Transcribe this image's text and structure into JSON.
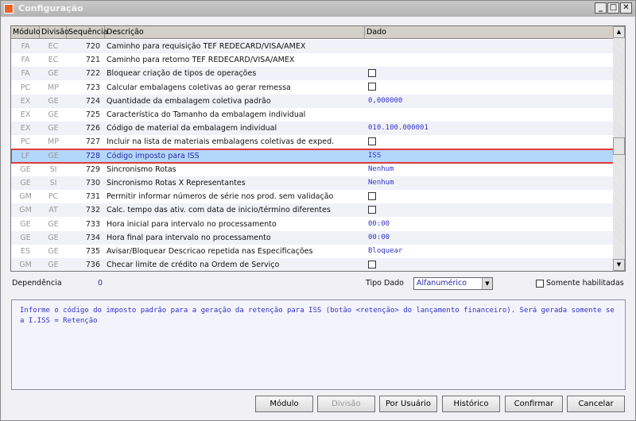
{
  "window": {
    "title": "Configuração",
    "controls": [
      "_",
      "□",
      "✕"
    ]
  },
  "grid": {
    "columns": [
      "Módulo",
      "Divisão",
      "Sequência",
      "Descrição",
      "Dado"
    ],
    "rows": [
      {
        "modulo": "FA",
        "divisao": "EC",
        "seq": "720",
        "descricao": "Caminho para requisição TEF REDECARD/VISA/AMEX",
        "dado": ""
      },
      {
        "modulo": "FA",
        "divisao": "EC",
        "seq": "721",
        "descricao": "Caminho para retorno TEF REDECARD/VISA/AMEX",
        "dado": ""
      },
      {
        "modulo": "FA",
        "divisao": "GE",
        "seq": "722",
        "descricao": "Bloquear criação de tipos de operações",
        "checkbox": true
      },
      {
        "modulo": "PC",
        "divisao": "MP",
        "seq": "723",
        "descricao": "Calcular embalagens coletivas ao gerar remessa",
        "checkbox": true
      },
      {
        "modulo": "EX",
        "divisao": "GE",
        "seq": "724",
        "descricao": "Quantidade da embalagem coletiva padrão",
        "dado": "0,000000"
      },
      {
        "modulo": "EX",
        "divisao": "GE",
        "seq": "725",
        "descricao": "Característica do Tamanho da embalagem individual",
        "dado": ""
      },
      {
        "modulo": "EX",
        "divisao": "GE",
        "seq": "726",
        "descricao": "Código de material da embalagem individual",
        "dado": "010.100.000001"
      },
      {
        "modulo": "PC",
        "divisao": "MP",
        "seq": "727",
        "descricao": "Incluir na lista de materiais embalagens coletivas de exped.",
        "checkbox": true
      },
      {
        "modulo": "LF",
        "divisao": "GE",
        "seq": "728",
        "descricao": "Código imposto para ISS",
        "dado": "ISS",
        "selected": true
      },
      {
        "modulo": "GE",
        "divisao": "SI",
        "seq": "729",
        "descricao": "Sincronismo Rotas",
        "dado": "Nenhum"
      },
      {
        "modulo": "GE",
        "divisao": "SI",
        "seq": "730",
        "descricao": "Sincronismo Rotas X Representantes",
        "dado": "Nenhum"
      },
      {
        "modulo": "GM",
        "divisao": "PC",
        "seq": "731",
        "descricao": "Permitir informar números de série nos prod. sem validação",
        "checkbox": true
      },
      {
        "modulo": "GM",
        "divisao": "AT",
        "seq": "732",
        "descricao": "Calc. tempo das ativ. com data de inicio/término diferentes",
        "checkbox": true
      },
      {
        "modulo": "GE",
        "divisao": "GE",
        "seq": "733",
        "descricao": "Hora inicial para intervalo no processamento",
        "dado": "00:00"
      },
      {
        "modulo": "GE",
        "divisao": "GE",
        "seq": "734",
        "descricao": "Hora final para intervalo no processamento",
        "dado": "00:00"
      },
      {
        "modulo": "ES",
        "divisao": "GE",
        "seq": "735",
        "descricao": "Avisar/Bloquear Descricao repetida nas Especificações",
        "dado": "Bloquear"
      },
      {
        "modulo": "GM",
        "divisao": "GE",
        "seq": "736",
        "descricao": "Checar limite de crédito na Ordem de Serviço",
        "checkbox": true
      }
    ]
  },
  "footer": {
    "dependencia_label": "Dependência",
    "dependencia_value": "0",
    "tipo_dado_label": "Tipo Dado",
    "tipo_dado_value": "Alfanumérico",
    "somente_label": "Somente habilitadas",
    "description": "Informe o código do imposto padrão para a geração da retenção para ISS (botão <retenção> do lançamento financeiro). Será gerada somente se a I.ISS = Retenção"
  },
  "buttons": {
    "modulo": "Módulo",
    "divisao": "Divisão",
    "por_usuario": "Por Usuário",
    "historico": "Histórico",
    "confirmar": "Confirmar",
    "cancelar": "Cancelar"
  }
}
